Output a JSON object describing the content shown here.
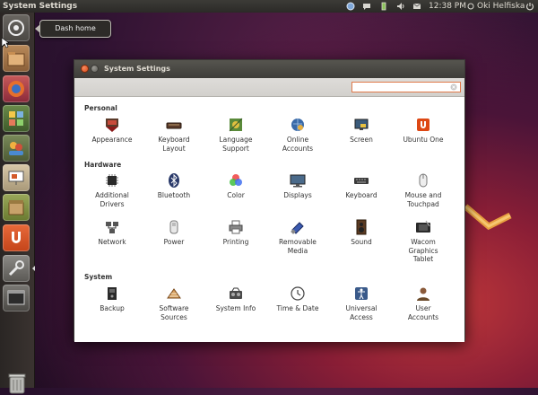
{
  "top_panel": {
    "title": "System Settings",
    "clock": "12:38 PM",
    "user": "Oki Helfiska",
    "indicators": [
      "network-icon",
      "messages-icon",
      "battery-icon",
      "volume-icon",
      "mail-icon",
      "power-icon"
    ]
  },
  "tooltip": {
    "text": "Dash home"
  },
  "launcher": {
    "items": [
      "dash-home",
      "files",
      "firefox",
      "workspaces",
      "people",
      "presentation",
      "archive",
      "ubuntu-one",
      "system-settings",
      "terminal",
      "trash"
    ]
  },
  "window": {
    "title": "System Settings",
    "search": {
      "value": "",
      "placeholder": ""
    },
    "sections": [
      {
        "title": "Personal",
        "items": [
          {
            "label": "Appearance",
            "icon": "appearance-icon"
          },
          {
            "label": "Keyboard\nLayout",
            "icon": "keyboard-layout-icon"
          },
          {
            "label": "Language\nSupport",
            "icon": "language-support-icon"
          },
          {
            "label": "Online\nAccounts",
            "icon": "online-accounts-icon"
          },
          {
            "label": "Screen",
            "icon": "screen-icon"
          },
          {
            "label": "Ubuntu One",
            "icon": "ubuntu-one-icon"
          }
        ]
      },
      {
        "title": "Hardware",
        "items": [
          {
            "label": "Additional\nDrivers",
            "icon": "additional-drivers-icon"
          },
          {
            "label": "Bluetooth",
            "icon": "bluetooth-icon"
          },
          {
            "label": "Color",
            "icon": "color-icon"
          },
          {
            "label": "Displays",
            "icon": "displays-icon"
          },
          {
            "label": "Keyboard",
            "icon": "keyboard-icon"
          },
          {
            "label": "Mouse and\nTouchpad",
            "icon": "mouse-icon"
          },
          {
            "label": "Network",
            "icon": "network-icon"
          },
          {
            "label": "Power",
            "icon": "power-icon"
          },
          {
            "label": "Printing",
            "icon": "printing-icon"
          },
          {
            "label": "Removable\nMedia",
            "icon": "removable-media-icon"
          },
          {
            "label": "Sound",
            "icon": "sound-icon"
          },
          {
            "label": "Wacom\nGraphics\nTablet",
            "icon": "wacom-tablet-icon"
          }
        ]
      },
      {
        "title": "System",
        "items": [
          {
            "label": "Backup",
            "icon": "backup-icon"
          },
          {
            "label": "Software\nSources",
            "icon": "software-sources-icon"
          },
          {
            "label": "System Info",
            "icon": "system-info-icon"
          },
          {
            "label": "Time & Date",
            "icon": "time-date-icon"
          },
          {
            "label": "Universal\nAccess",
            "icon": "universal-access-icon"
          },
          {
            "label": "User\nAccounts",
            "icon": "user-accounts-icon"
          }
        ]
      }
    ]
  },
  "colors": {
    "panel": "#3c3b37",
    "accent": "#dd4814",
    "window_bg": "#ffffff"
  }
}
